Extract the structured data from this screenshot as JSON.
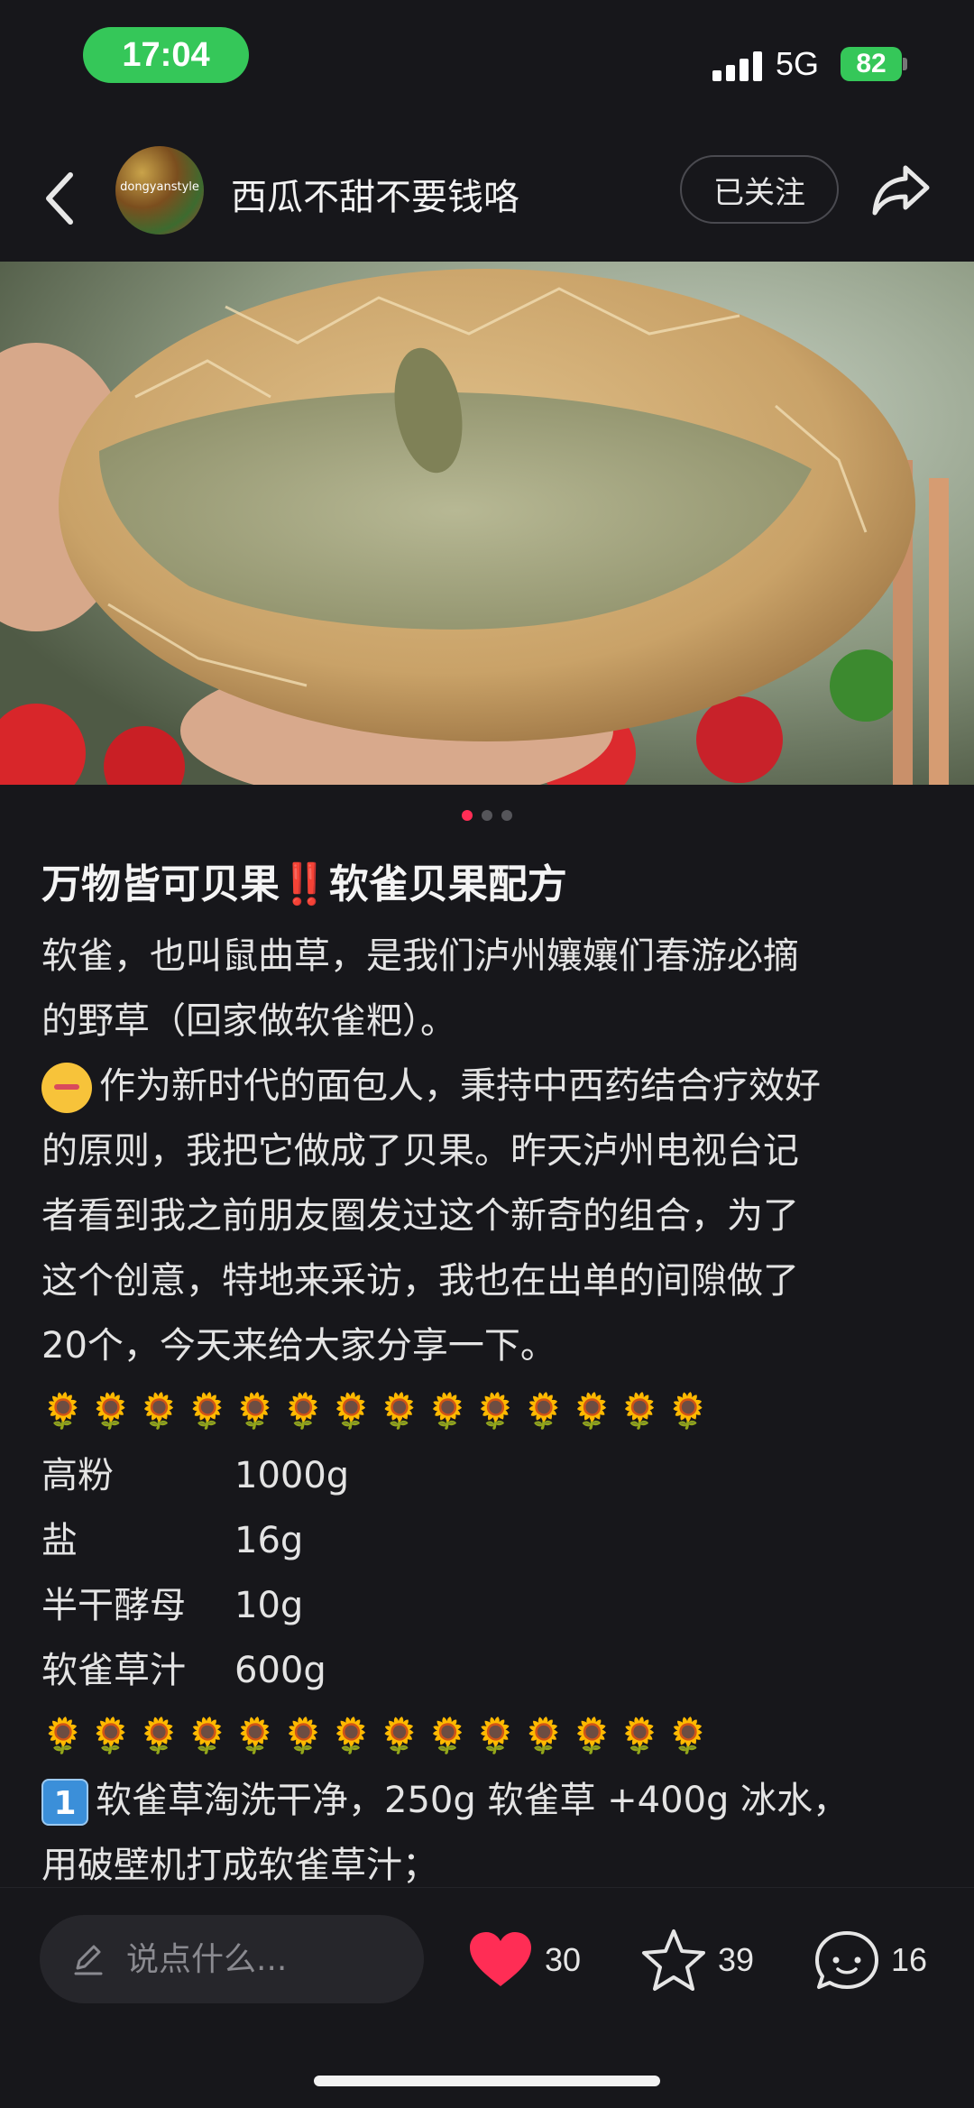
{
  "status_bar": {
    "time": "17:04",
    "network": "5G",
    "battery": "82"
  },
  "header": {
    "author_name": "西瓜不甜不要钱咯",
    "avatar_text": "dongyanstyle",
    "follow_label": "已关注"
  },
  "carousel": {
    "count": 3,
    "active": 0
  },
  "post": {
    "title": "万物皆可贝果‼️软雀贝果配方",
    "lines": [
      "软雀，也叫鼠曲草，是我们泸州孃孃们春游必摘",
      "的野草（回家做软雀粑）。",
      "作为新时代的面包人，秉持中西药结合疗效好",
      "的原则，我把它做成了贝果。昨天泸州电视台记",
      "者看到我之前朋友圈发过这个新奇的组合，为了",
      "这个创意，特地来采访，我也在出单的间隙做了",
      " 20个，今天来给大家分享一下。"
    ],
    "sun_row": "🌻🌻🌻🌻🌻🌻🌻🌻🌻🌻🌻🌻🌻🌻",
    "ingredients": [
      {
        "name": "高粉",
        "amount": "1000g"
      },
      {
        "name": "盐",
        "amount": "16g"
      },
      {
        "name": "半干酵母",
        "amount": "10g"
      },
      {
        "name": "软雀草汁",
        "amount": "600g"
      }
    ],
    "step1_badge": "1",
    "step1_line1": "软雀草淘洗干净，250g 软雀草 +400g 冰水，",
    "step1_line2": "用破壁机打成软雀草汁；"
  },
  "bottom_bar": {
    "comment_placeholder": "说点什么...",
    "likes": "30",
    "stars": "39",
    "comments": "16"
  },
  "colors": {
    "background": "#17171b",
    "accent_like": "#ff2d55",
    "status_green": "#35c759"
  }
}
